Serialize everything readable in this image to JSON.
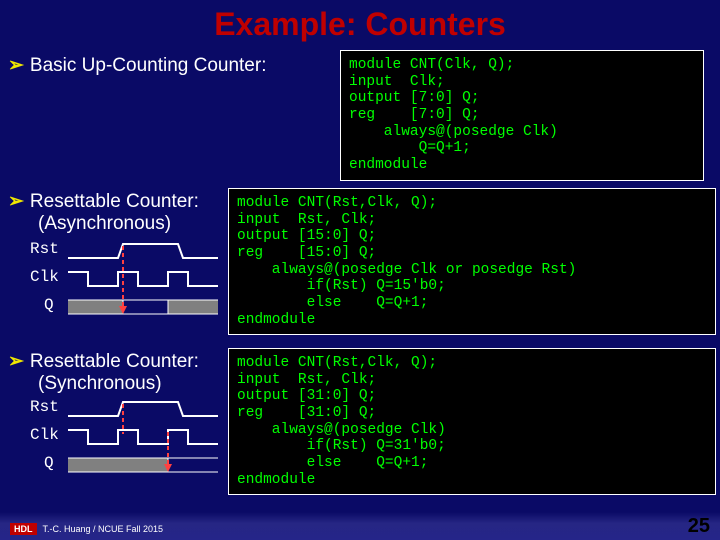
{
  "title": "Example: Counters",
  "bullets": {
    "b1": "Basic Up-Counting Counter:",
    "b2": "Resettable Counter:",
    "b2sub": "(Asynchronous)",
    "b3": "Resettable Counter:",
    "b3sub": "(Synchronous)"
  },
  "signals": {
    "rst": "Rst",
    "clk": "Clk",
    "q": "Q"
  },
  "code1": "module CNT(Clk, Q);\ninput  Clk;\noutput [7:0] Q;\nreg    [7:0] Q;\n    always@(posedge Clk)\n        Q=Q+1;\nendmodule",
  "code2": "module CNT(Rst,Clk, Q);\ninput  Rst, Clk;\noutput [15:0] Q;\nreg    [15:0] Q;\n    always@(posedge Clk or posedge Rst)\n        if(Rst) Q=15'b0;\n        else    Q=Q+1;\nendmodule",
  "code3": "module CNT(Rst,Clk, Q);\ninput  Rst, Clk;\noutput [31:0] Q;\nreg    [31:0] Q;\n    always@(posedge Clk)\n        if(Rst) Q=31'b0;\n        else    Q=Q+1;\nendmodule",
  "footer": {
    "hdl": "HDL",
    "credit": "T.-C. Huang / NCUE  Fall 2015"
  },
  "pagenum": "25"
}
